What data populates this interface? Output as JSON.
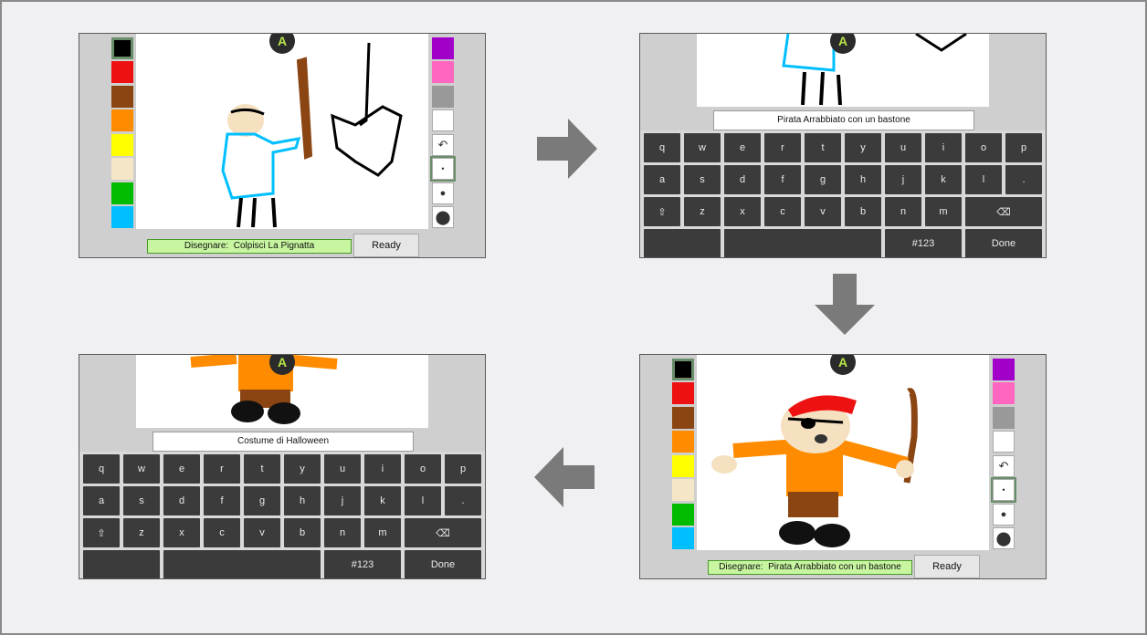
{
  "panels": {
    "p1": {
      "prompt_label": "Disegnare:",
      "prompt_value": "Colpisci La Pignatta",
      "ready": "Ready"
    },
    "p2": {
      "typed_text": "Pirata Arrabbiato con un bastone"
    },
    "p3": {
      "prompt_label": "Disegnare:",
      "prompt_value": "Pirata Arrabbiato con un bastone",
      "ready": "Ready"
    },
    "p4": {
      "typed_text": "Costume di Halloween"
    }
  },
  "keyboard": {
    "row1": [
      "q",
      "w",
      "e",
      "r",
      "t",
      "y",
      "u",
      "i",
      "o",
      "p"
    ],
    "row2": [
      "a",
      "s",
      "d",
      "f",
      "g",
      "h",
      "j",
      "k",
      "l",
      "."
    ],
    "row3": [
      "z",
      "x",
      "c",
      "v",
      "b",
      "n",
      "m"
    ],
    "shift": "⇧",
    "backspace": "⌫",
    "numbers": "#123",
    "done": "Done"
  },
  "logo_glyph": "A",
  "colors": {
    "palette_left": [
      "#000000",
      "#ee1111",
      "#8b4513",
      "#ff8c00",
      "#ffff00",
      "#f5e6c8",
      "#00bb00",
      "#00bfff"
    ],
    "palette_right": [
      "#a000c8",
      "#ff66c0",
      "#999999",
      "#ffffff"
    ],
    "prompt_bg": "#c7f5a0",
    "arrow": "#7a7a7a"
  },
  "tools": {
    "undo": "↶",
    "brush_small": "•",
    "brush_medium": "●",
    "brush_large": "⬤"
  }
}
